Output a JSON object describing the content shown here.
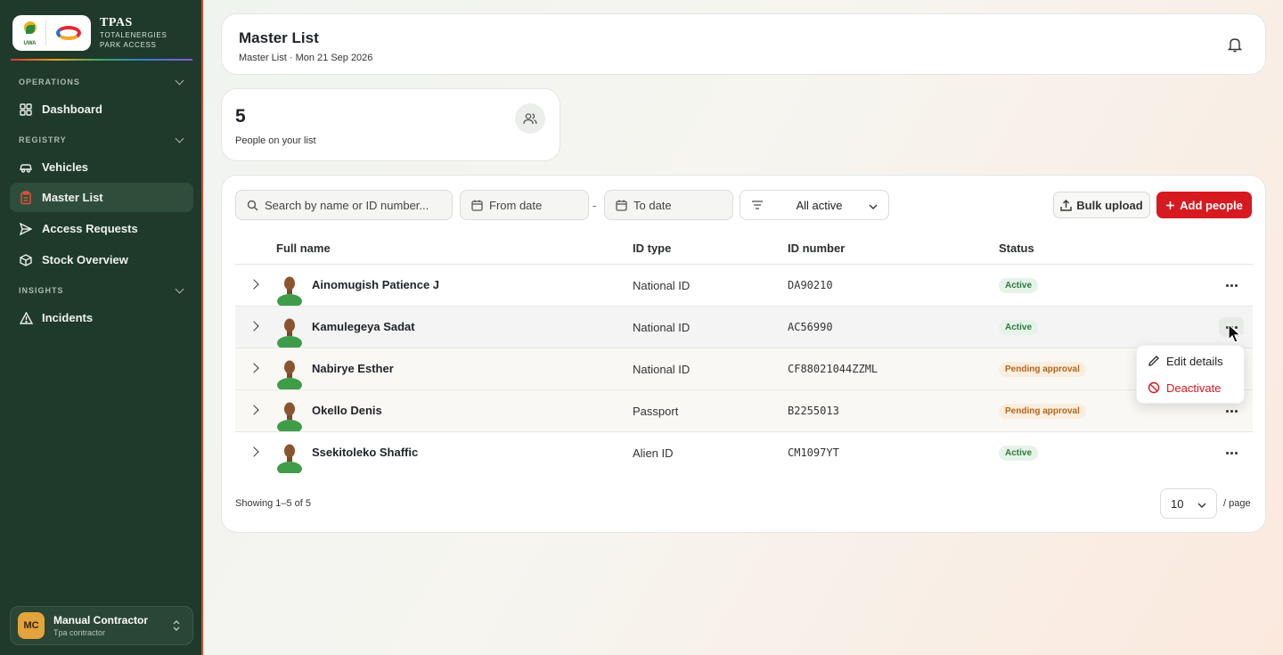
{
  "brand": {
    "title": "TPAS",
    "subtitle_line1": "TOTALENERGIES",
    "subtitle_line2": "PARK ACCESS",
    "uwa_text": "UWA"
  },
  "sidebar": {
    "sections": [
      {
        "label": "OPERATIONS"
      },
      {
        "label": "REGISTRY"
      },
      {
        "label": "INSIGHTS"
      }
    ],
    "items": [
      {
        "label": "Dashboard",
        "icon": "grid-icon"
      },
      {
        "label": "Vehicles",
        "icon": "car-icon"
      },
      {
        "label": "Master List",
        "icon": "clipboard-icon",
        "active": true
      },
      {
        "label": "Access Requests",
        "icon": "send-icon"
      },
      {
        "label": "Stock Overview",
        "icon": "box-icon"
      },
      {
        "label": "Incidents",
        "icon": "warning-icon"
      }
    ],
    "user": {
      "initials": "MC",
      "name": "Manual Contractor",
      "role": "Tpa contractor"
    }
  },
  "header": {
    "title": "Master List",
    "subtitle": "Master List · Mon 21 Sep 2026"
  },
  "stat": {
    "value": "5",
    "label": "People on your list"
  },
  "toolbar": {
    "search_placeholder": "Search by name or ID number...",
    "from_date": "From date",
    "to_date": "To date",
    "separator": "-",
    "filter_value": "All active",
    "bulk_upload": "Bulk upload",
    "add_people": "Add people"
  },
  "table": {
    "columns": [
      "Full name",
      "ID type",
      "ID number",
      "Status"
    ],
    "rows": [
      {
        "name": "Ainomugish Patience J",
        "id_type": "National ID",
        "id_number": "DA90210",
        "status": "Active"
      },
      {
        "name": "Kamulegeya Sadat",
        "id_type": "National ID",
        "id_number": "AC56990",
        "status": "Active"
      },
      {
        "name": "Nabirye Esther",
        "id_type": "National ID",
        "id_number": "CF88021044ZZML",
        "status": "Pending approval"
      },
      {
        "name": "Okello Denis",
        "id_type": "Passport",
        "id_number": "B2255013",
        "status": "Pending approval"
      },
      {
        "name": "Ssekitoleko Shaffic",
        "id_type": "Alien ID",
        "id_number": "CM1097YT",
        "status": "Active"
      }
    ]
  },
  "footer": {
    "showing": "Showing 1–5 of 5",
    "page_size": "10",
    "per_page": "/ page"
  },
  "row_menu": {
    "edit": "Edit details",
    "deactivate": "Deactivate"
  },
  "colors": {
    "sidebar": "#1f3a2b",
    "accent_red": "#d71920",
    "active_badge": "#2f7a41",
    "pending_badge": "#b4661d"
  }
}
